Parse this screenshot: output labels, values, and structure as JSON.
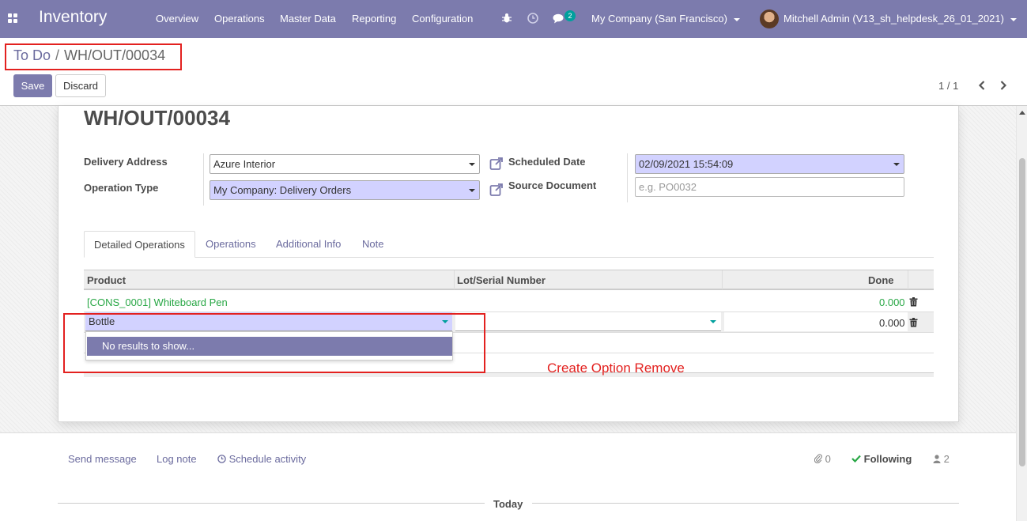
{
  "navbar": {
    "app_title": "Inventory",
    "menu": [
      "Overview",
      "Operations",
      "Master Data",
      "Reporting",
      "Configuration"
    ],
    "message_count": "2",
    "company": "My Company (San Francisco)",
    "user": "Mitchell Admin (V13_sh_helpdesk_26_01_2021)"
  },
  "breadcrumb": {
    "parent": "To Do",
    "separator": "/",
    "current": "WH/OUT/00034"
  },
  "toolbar": {
    "save_label": "Save",
    "discard_label": "Discard",
    "pager": "1 / 1"
  },
  "record": {
    "title": "WH/OUT/00034",
    "delivery_address_label": "Delivery Address",
    "delivery_address_value": "Azure Interior",
    "operation_type_label": "Operation Type",
    "operation_type_value": "My Company: Delivery Orders",
    "scheduled_date_label": "Scheduled Date",
    "scheduled_date_value": "02/09/2021 15:54:09",
    "source_document_label": "Source Document",
    "source_document_placeholder": "e.g. PO0032"
  },
  "tabs": [
    "Detailed Operations",
    "Operations",
    "Additional Info",
    "Note"
  ],
  "table": {
    "headers": [
      "Product",
      "Lot/Serial Number",
      "Done"
    ],
    "rows": [
      {
        "product": "[CONS_0001] Whiteboard Pen",
        "done": "0.000"
      },
      {
        "product": "Bottle",
        "done": "0.000"
      }
    ]
  },
  "autocomplete": {
    "no_results": "No results to show..."
  },
  "annotation": "Create Option Remove",
  "chatter": {
    "send_message": "Send message",
    "log_note": "Log note",
    "schedule_activity": "Schedule activity",
    "attachments": "0",
    "following": "Following",
    "followers": "2",
    "today": "Today"
  },
  "colors": {
    "brand": "#7c7bad",
    "required_field": "#d2d2ff",
    "link_green": "#28a745",
    "annotation_red": "#e3211f"
  }
}
